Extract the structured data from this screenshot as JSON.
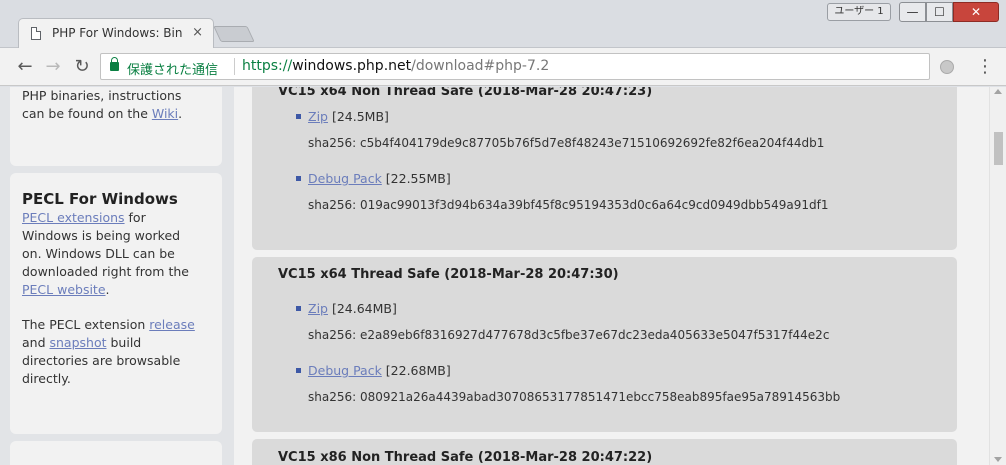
{
  "window": {
    "user_label": "ユーザー 1",
    "min_label": "—",
    "max_label": "☐",
    "close_label": "✕"
  },
  "tab": {
    "title": "PHP For Windows: Bin",
    "close": "×"
  },
  "toolbar": {
    "back": "←",
    "forward": "→",
    "reload": "↻",
    "secure_label": "保護された通信",
    "url_scheme": "https://",
    "url_host": "windows.php.net",
    "url_path": "/download#php-7.2",
    "star": "☆",
    "menu": "⋮"
  },
  "sidebar": {
    "panel1": {
      "line1": "PHP binaries, instructions",
      "line2_prefix": "can be found on the ",
      "line2_link": "Wiki",
      "line2_suffix": "."
    },
    "panel2": {
      "heading": "PECL For Windows",
      "p1_link": "PECL extensions",
      "p1_after_link": " for",
      "p1_line2": "Windows is being worked",
      "p1_line3": "on. Windows DLL can be",
      "p1_line4": "downloaded right from the",
      "p1_link2": "PECL website",
      "p1_after_link2": ".",
      "p2_line1_prefix": "The PECL extension ",
      "p2_link1": "release",
      "p2_line2_prefix": "and ",
      "p2_link2": "snapshot",
      "p2_line2_suffix": " build",
      "p2_line3": "directories are browsable",
      "p2_line4": "directly."
    }
  },
  "builds": [
    {
      "title": "VC15 x64 Non Thread Safe (2018-Mar-28 20:47:23)",
      "zip_label": "Zip",
      "zip_size": " [24.5MB]",
      "zip_sha": "sha256: c5b4f404179de9c87705b76f5d7e8f48243e71510692692fe82f6ea204f44db1",
      "debug_label": "Debug Pack",
      "debug_size": " [22.55MB]",
      "debug_sha": "sha256: 019ac99013f3d94b634a39bf45f8c95194353d0c6a64c9cd0949dbb549a91df1"
    },
    {
      "title": "VC15 x64 Thread Safe (2018-Mar-28 20:47:30)",
      "zip_label": "Zip",
      "zip_size": " [24.64MB]",
      "zip_sha": "sha256: e2a89eb6f8316927d477678d3c5fbe37e67dc23eda405633e5047f5317f44e2c",
      "debug_label": "Debug Pack",
      "debug_size": " [22.68MB]",
      "debug_sha": "sha256: 080921a26a4439abad30708653177851471ebcc758eab895fae95a78914563bb"
    },
    {
      "title": "VC15 x86 Non Thread Safe (2018-Mar-28 20:47:22)"
    }
  ]
}
